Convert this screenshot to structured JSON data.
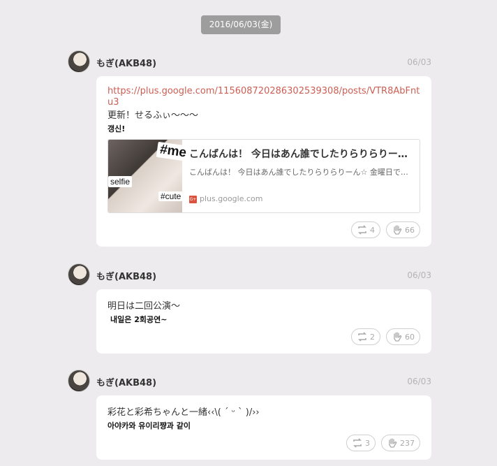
{
  "date_badge": "2016/06/03(金)",
  "posts": [
    {
      "author": "もぎ(AKB48)",
      "time": "06/03",
      "link": "https://plus.google.com/115608720286302539308/posts/VTR8AbFntu3",
      "text_ja": "更新！せるふぃ〜〜〜",
      "text_ko": "갱신!",
      "preview": {
        "title": "こんばんは！ 今日はあん誰でしたりらりらりーん☆ 金曜日",
        "desc": "こんばんは！ 今日はあん誰でしたりらりらりーん☆ 金曜日でしたね",
        "domain": "plus.google.com",
        "tag1": "#me",
        "tag2": "selfie",
        "tag3": "#cute"
      },
      "retweets": "4",
      "likes": "66"
    },
    {
      "author": "もぎ(AKB48)",
      "time": "06/03",
      "text_ja": "明日は二回公演〜",
      "text_ko": "내일은 2회공연~",
      "retweets": "2",
      "likes": "60"
    },
    {
      "author": "もぎ(AKB48)",
      "time": "06/03",
      "text_ja": "彩花と彩希ちゃんと一緒‹‹\\( ´ ᵕ ` )/››",
      "text_ko": "아야카와 유이리쨩과 같이",
      "retweets": "3",
      "likes": "237"
    }
  ]
}
